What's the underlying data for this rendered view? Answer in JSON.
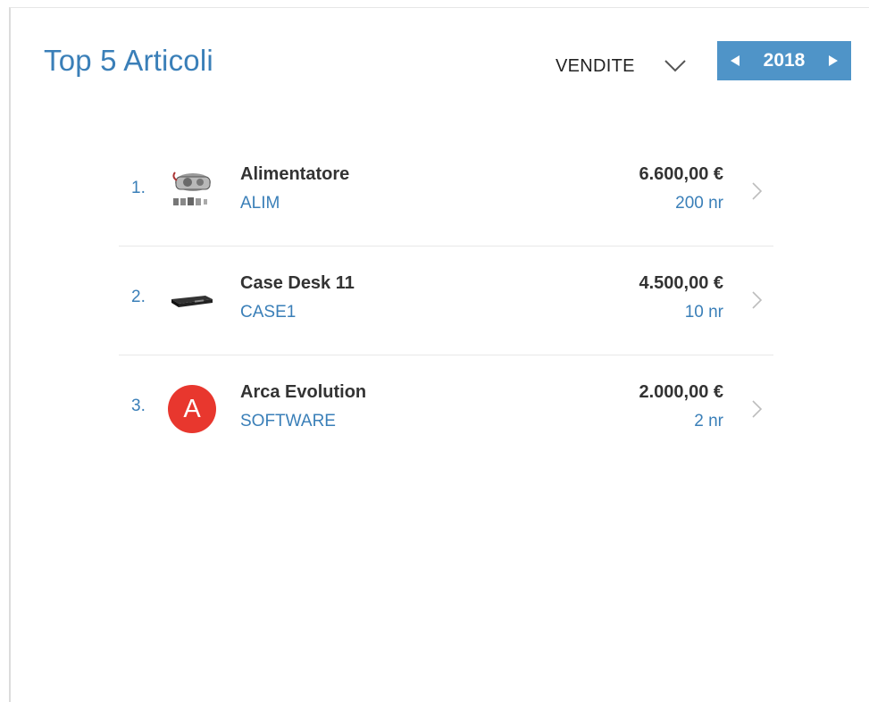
{
  "widget": {
    "title": "Top 5 Articoli",
    "metric_selected": "VENDITE",
    "year": "2018",
    "accent_color": "#4f94c8",
    "title_color": "#3a7fb8"
  },
  "items": [
    {
      "rank": "1.",
      "name": "Alimentatore",
      "code": "ALIM",
      "amount": "6.600,00 €",
      "quantity": "200 nr",
      "image": "power-supply-photo"
    },
    {
      "rank": "2.",
      "name": "Case Desk 11",
      "code": "CASE1",
      "amount": "4.500,00 €",
      "quantity": "10 nr",
      "image": "desktop-case-photo"
    },
    {
      "rank": "3.",
      "name": "Arca Evolution",
      "code": "SOFTWARE",
      "amount": "2.000,00 €",
      "quantity": "2 nr",
      "image": "letter-avatar",
      "avatar_letter": "A",
      "avatar_color": "#e8372e"
    }
  ]
}
